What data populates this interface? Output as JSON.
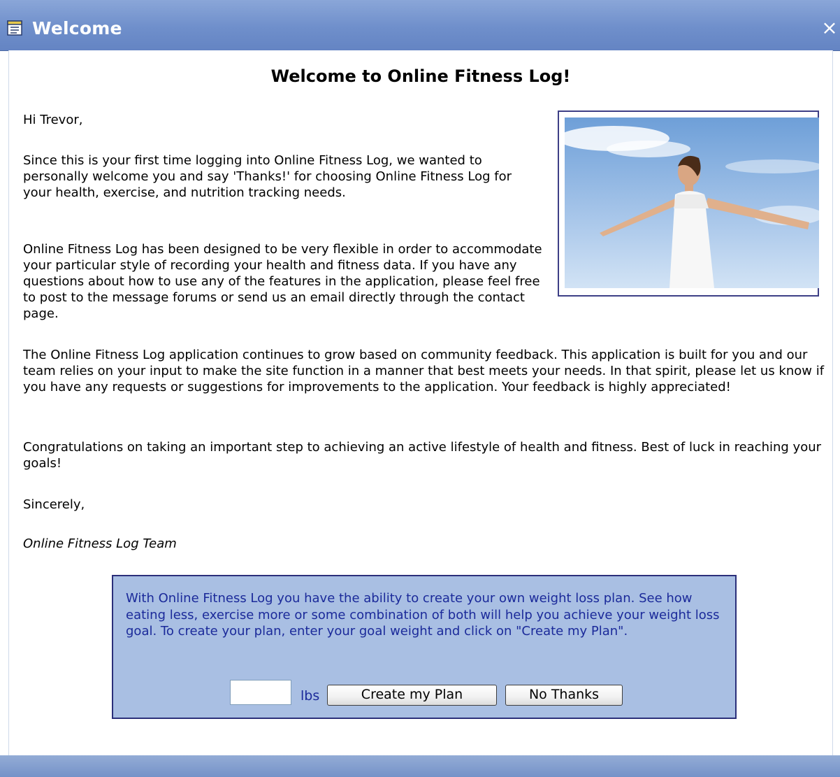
{
  "window": {
    "title": "Welcome",
    "close_glyph": "×",
    "icon": "notepad-icon",
    "accent_color": "#6f8fcb"
  },
  "content": {
    "heading": "Welcome to Online Fitness Log!",
    "greeting": "Hi Trevor,",
    "paragraphs": [
      "Since this is your first time logging into Online Fitness Log, we wanted to personally welcome you and say 'Thanks!' for choosing Online Fitness Log for your health, exercise, and nutrition tracking needs.",
      "Online Fitness Log has been designed to be very flexible in order to accommodate your particular style of recording your health and fitness data. If you have any questions about how to use any of the features in the application, please feel free to post to the message forums or send us an email directly through the contact page.",
      "The Online Fitness Log application continues to grow based on community feedback. This application is built for you and our team relies on your input to make the site function in a manner that best meets your needs. In that spirit, please let us know if you have any requests or suggestions for improvements to the application. Your feedback is highly appreciated!",
      "Congratulations on taking an important step to achieving an active lifestyle of health and fitness. Best of luck in reaching your goals!"
    ],
    "closing": "Sincerely,",
    "signature": "Online Fitness Log Team"
  },
  "plan": {
    "text": "With Online Fitness Log you have the ability to create your own weight loss plan. See how eating less, exercise more or some combination of both will help you achieve your weight loss goal. To create your plan, enter your goal weight and click on \"Create my Plan\".",
    "weight_value": "",
    "unit": "lbs",
    "create_label": "Create my Plan",
    "no_thanks_label": "No Thanks",
    "box_color": "#a9bfe3",
    "text_color": "#1b2a9a"
  }
}
